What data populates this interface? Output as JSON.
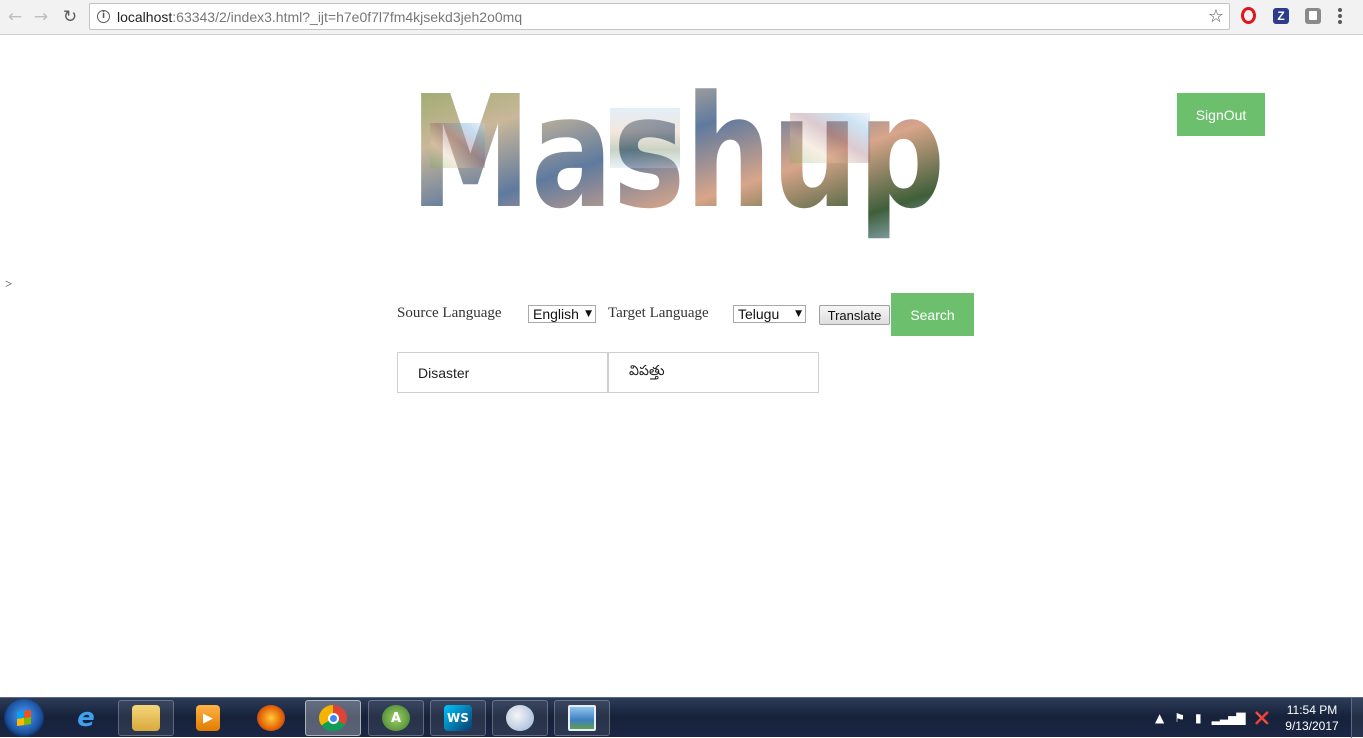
{
  "browser": {
    "url_host": "localhost",
    "url_rest": ":63343/2/index3.html?_ijt=h7e0f7l7fm4kjsekd3jeh2o0mq"
  },
  "page": {
    "logo_text": "Mashup",
    "signout_label": "SignOut",
    "stray_text": ">",
    "source_label": "Source Language",
    "source_value": "English",
    "target_label": "Target Language",
    "target_value": "Telugu",
    "translate_label": "Translate",
    "search_label": "Search",
    "input_word": "Disaster",
    "translated_word": "విపత్తు"
  },
  "taskbar": {
    "time": "11:54 PM",
    "date": "9/13/2017",
    "apps": [
      "internet-explorer",
      "file-explorer",
      "media-player",
      "firefox",
      "chrome",
      "android-studio",
      "webstorm",
      "paint",
      "photo-viewer"
    ]
  },
  "colors": {
    "accent_green": "#6cbf6d"
  }
}
